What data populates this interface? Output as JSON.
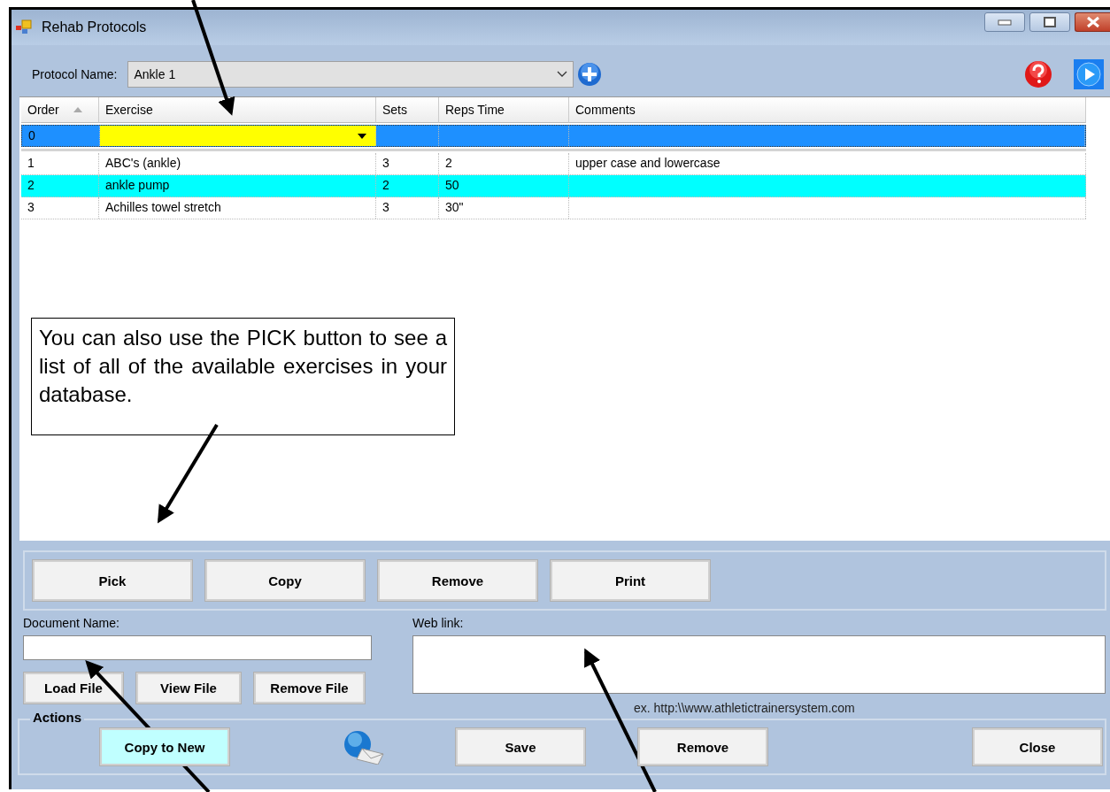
{
  "window": {
    "title": "Rehab Protocols"
  },
  "protocol": {
    "label": "Protocol Name:",
    "value": "Ankle 1"
  },
  "grid": {
    "columns": [
      {
        "label": "Order",
        "sorted": true
      },
      {
        "label": "Exercise",
        "sorted": false
      },
      {
        "label": "Sets",
        "sorted": false
      },
      {
        "label": "Reps Time",
        "sorted": false
      },
      {
        "label": "Comments",
        "sorted": false
      }
    ],
    "rows": [
      {
        "cells": [
          "0",
          "",
          "",
          "",
          ""
        ],
        "selected": true,
        "editing": true,
        "highlighted": false
      },
      {
        "cells": [
          "1",
          "ABC's (ankle)",
          "3",
          "2",
          "upper case and lowercase"
        ],
        "selected": false,
        "editing": false,
        "highlighted": false
      },
      {
        "cells": [
          "2",
          "ankle pump",
          "2",
          "50",
          ""
        ],
        "selected": false,
        "editing": false,
        "highlighted": true
      },
      {
        "cells": [
          "3",
          "Achilles towel stretch",
          "3",
          "30\"",
          ""
        ],
        "selected": false,
        "editing": false,
        "highlighted": false
      }
    ]
  },
  "grid_buttons": [
    "Pick",
    "Copy",
    "Remove",
    "Print"
  ],
  "document": {
    "label": "Document Name:",
    "buttons": [
      "Load File",
      "View File",
      "Remove File"
    ]
  },
  "web_link": {
    "label": "Web link:",
    "hint": "ex.  http:\\\\www.athletictrainersystem.com"
  },
  "actions": {
    "legend": "Actions",
    "buttons": [
      {
        "label": "Copy to New",
        "highlighted": true
      },
      {
        "label": "Save",
        "highlighted": false
      },
      {
        "label": "Remove",
        "highlighted": false
      },
      {
        "label": "Close",
        "highlighted": false
      }
    ]
  },
  "annotations": [
    {
      "text": "You can also use the PICK button to see a list of all of the available exercises in your database."
    }
  ]
}
